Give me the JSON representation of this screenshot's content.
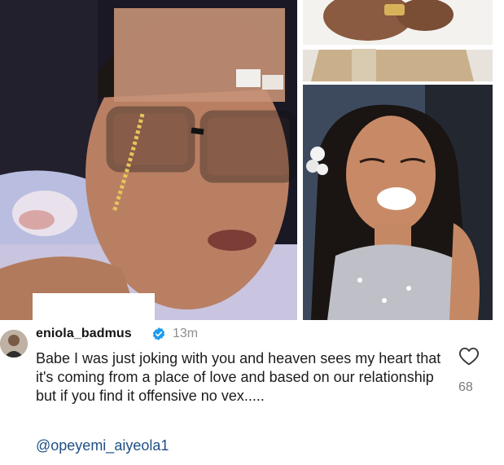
{
  "comment": {
    "username": "eniola_badmus",
    "time": "13m",
    "text": "Babe I was just joking with you and heaven sees my heart that it's coming from a place of love and based on our relationship but if you find it offensive no vex.....",
    "mention": "@opeyemi_aiyeola1",
    "like_count": "68"
  },
  "icons": {
    "verified": "verified-badge-icon",
    "like": "heart-icon"
  },
  "colors": {
    "verified_blue": "#1d9bf0",
    "mention_blue": "#1f4f85",
    "timestamp_gray": "#8e8e8e"
  }
}
